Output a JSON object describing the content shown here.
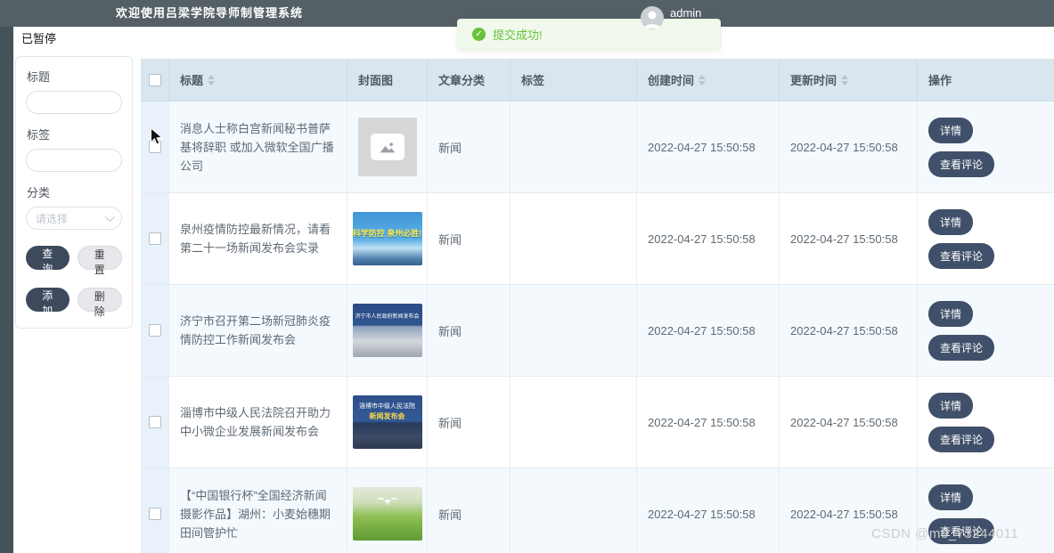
{
  "header": {
    "title": "欢迎使用吕梁学院导师制管理系统",
    "username": "admin"
  },
  "toast": {
    "text": "提交成功!"
  },
  "status_label": "已暂停",
  "filter": {
    "title_label": "标题",
    "tag_label": "标签",
    "category_label": "分类",
    "category_placeholder": "请选择",
    "buttons": {
      "search": "查询",
      "reset": "重置",
      "add": "添加",
      "delete": "删除"
    }
  },
  "table": {
    "columns": [
      {
        "label": "标题",
        "sortable": true
      },
      {
        "label": "封面图",
        "sortable": false
      },
      {
        "label": "文章分类",
        "sortable": false
      },
      {
        "label": "标签",
        "sortable": false
      },
      {
        "label": "创建时间",
        "sortable": true
      },
      {
        "label": "更新时间",
        "sortable": true
      },
      {
        "label": "操作",
        "sortable": false
      }
    ],
    "action_labels": {
      "detail": "详情",
      "comments": "查看评论"
    },
    "rows": [
      {
        "title": "消息人士称白宫新闻秘书普萨基将辞职 或加入微软全国广播公司",
        "cover": "placeholder",
        "category": "新闻",
        "tag": "",
        "created": "2022-04-27 15:50:58",
        "updated": "2022-04-27 15:50:58"
      },
      {
        "title": "泉州疫情防控最新情况，请看第二十一场新闻发布会实录",
        "cover": "poster-blue",
        "cover_text": "科学防控 泉州必胜!",
        "category": "新闻",
        "tag": "",
        "created": "2022-04-27 15:50:58",
        "updated": "2022-04-27 15:50:58"
      },
      {
        "title": "济宁市召开第二场新冠肺炎疫情防控工作新闻发布会",
        "cover": "press-conference",
        "cover_text": "济宁市人民政府新闻发布会",
        "category": "新闻",
        "tag": "",
        "created": "2022-04-27 15:50:58",
        "updated": "2022-04-27 15:50:58"
      },
      {
        "title": "淄博市中级人民法院召开助力中小微企业发展新闻发布会",
        "cover": "press-conference-dark",
        "cover_text": "淄博市中级人民法院",
        "cover_sub": "新闻发布会",
        "category": "新闻",
        "tag": "",
        "created": "2022-04-27 15:50:58",
        "updated": "2022-04-27 15:50:58"
      },
      {
        "title": "【“中国银行杯”全国经济新闻摄影作品】湖州：小麦始穗期 田间管护忙",
        "cover": "field-drone",
        "category": "新闻",
        "tag": "",
        "created": "2022-04-27 15:50:58",
        "updated": "2022-04-27 15:50:58"
      }
    ]
  },
  "watermark": "CSDN @m0_73244011"
}
